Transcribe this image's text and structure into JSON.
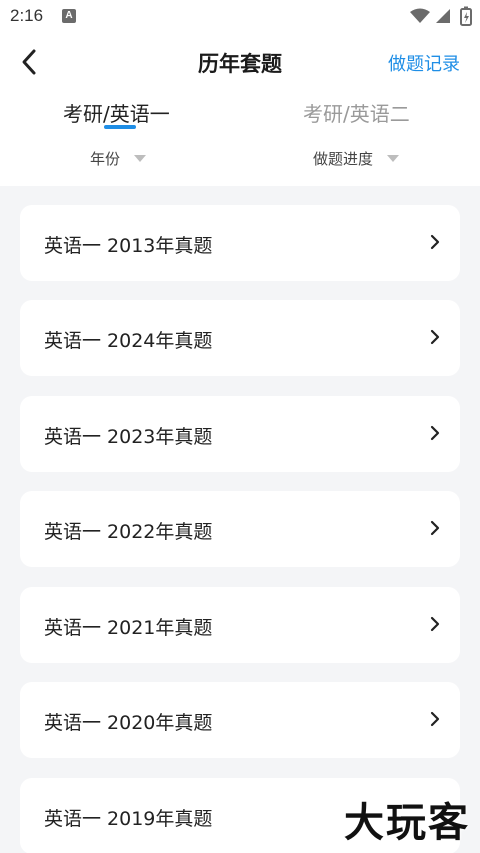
{
  "status_bar": {
    "time": "2:16",
    "notification_badge": "A",
    "icons": [
      "wifi-icon",
      "signal-icon",
      "battery-icon"
    ]
  },
  "nav": {
    "back_icon": "chevron-left-icon",
    "title": "历年套题",
    "record_label": "做题记录"
  },
  "tabs": [
    {
      "label": "考研/英语一",
      "active": true
    },
    {
      "label": "考研/英语二",
      "active": false
    }
  ],
  "filters": {
    "year_label": "年份",
    "progress_label": "做题进度"
  },
  "papers": [
    {
      "label": "英语一 2013年真题"
    },
    {
      "label": "英语一 2024年真题"
    },
    {
      "label": "英语一 2023年真题"
    },
    {
      "label": "英语一 2022年真题"
    },
    {
      "label": "英语一 2021年真题"
    },
    {
      "label": "英语一 2020年真题"
    },
    {
      "label": "英语一 2019年真题"
    }
  ],
  "watermark": "大玩客",
  "colors": {
    "accent": "#1f8ee6",
    "background": "#f4f5f7",
    "card": "#ffffff",
    "inactive_tab": "#9a9a9a"
  }
}
